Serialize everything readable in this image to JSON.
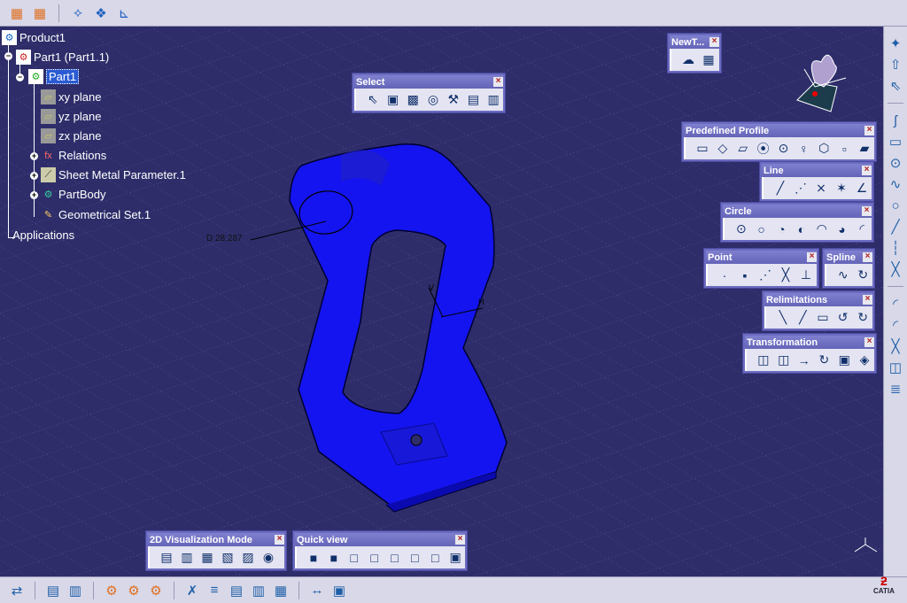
{
  "top_toolbar": {
    "icons": [
      "grid-icon",
      "snap-to-point-icon",
      "construction-element-icon",
      "geometrical-constraints-icon",
      "dimensional-constraints-icon"
    ]
  },
  "tree": {
    "root": "Product1",
    "part_instance": "Part1 (Part1.1)",
    "part": "Part1",
    "children": [
      "xy plane",
      "yz plane",
      "zx plane",
      "Relations",
      "Sheet Metal Parameter.1",
      "PartBody",
      "Geometrical Set.1"
    ],
    "applications": "Applications"
  },
  "viewport": {
    "dimension_label": "D 28.287",
    "axis_h": "H",
    "axis_v": "V"
  },
  "toolbars": {
    "select": {
      "title": "Select",
      "icons": [
        "⇖",
        "▣",
        "▩",
        "◎",
        "⚒",
        "▤",
        "▥"
      ]
    },
    "newt": {
      "title": "NewT...",
      "icons": [
        "☁",
        "▦"
      ]
    },
    "predefined_profile": {
      "title": "Predefined Profile",
      "icons": [
        "▭",
        "◇",
        "▱",
        "⦿",
        "⊙",
        "♀",
        "⬡",
        "▫",
        "▰"
      ]
    },
    "line": {
      "title": "Line",
      "icons": [
        "╱",
        "⋰",
        "⨯",
        "✶",
        "∠"
      ]
    },
    "circle": {
      "title": "Circle",
      "icons": [
        "⊙",
        "○",
        "◔",
        "◐",
        "◠",
        "◕",
        "◜"
      ]
    },
    "point": {
      "title": "Point",
      "icons": [
        "·",
        "▪",
        "⋰",
        "╳",
        "⊥"
      ]
    },
    "spline": {
      "title": "Spline",
      "icons": [
        "∿",
        "↻"
      ]
    },
    "relimitations": {
      "title": "Relimitations",
      "icons": [
        "╲",
        "╱",
        "▭",
        "↺",
        "↻"
      ]
    },
    "transformation": {
      "title": "Transformation",
      "icons": [
        "◫",
        "◫",
        "→",
        "↻",
        "▣",
        "◈"
      ]
    },
    "viz2d": {
      "title": "2D Visualization Mode",
      "icons": [
        "▤",
        "▥",
        "▦",
        "▧",
        "▨",
        "◉"
      ]
    },
    "quickview": {
      "title": "Quick view",
      "icons": [
        "■",
        "■",
        "□",
        "□",
        "□",
        "□",
        "□",
        "▣"
      ]
    }
  },
  "right_toolbar": {
    "icons": [
      "✦",
      "⇧",
      "⇖",
      "ʃ",
      "▭",
      "⊙",
      "∿",
      "○",
      "╱",
      "┆",
      "╳",
      "◜",
      "◜",
      "╳",
      "◫",
      "≣"
    ]
  },
  "bottom_toolbar": {
    "icons": [
      "⇄",
      "▤",
      "▥",
      "⚙",
      "⚙",
      "⚙",
      "✗",
      "≡",
      "▤",
      "▥",
      "▦",
      "↔",
      "▣"
    ]
  },
  "brand": {
    "logo_text": "CATIA"
  },
  "colors": {
    "background": "#2e2d6a",
    "part": "#1414f0",
    "toolbar": "#d8d8e8",
    "panel_title": "#6b6bc0"
  }
}
